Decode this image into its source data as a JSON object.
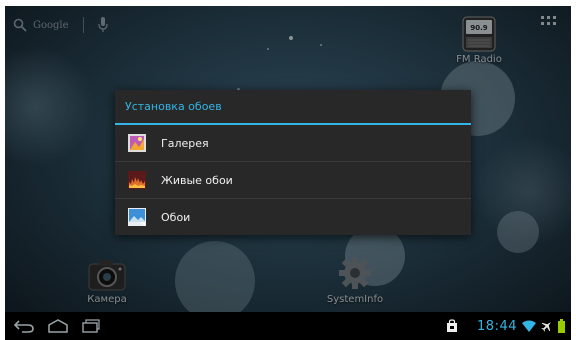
{
  "homescreen": {
    "search_label": "Google",
    "shortcuts": {
      "fm_radio": {
        "label": "FM Radio",
        "badge": "90.9"
      },
      "camera": {
        "label": "Камера"
      },
      "systeminfo": {
        "label": "SystemInfo"
      }
    }
  },
  "dialog": {
    "title": "Установка обоев",
    "items": [
      {
        "label": "Галерея",
        "icon": "gallery-icon"
      },
      {
        "label": "Живые обои",
        "icon": "live-wallpaper-icon"
      },
      {
        "label": "Обои",
        "icon": "wallpaper-icon"
      }
    ]
  },
  "statusbar": {
    "time": "18:44",
    "icons": [
      "notification-bag-icon",
      "wifi-icon",
      "airplane-icon",
      "battery-icon"
    ]
  },
  "navbar": {
    "icons": [
      "back-icon",
      "home-icon",
      "recent-apps-icon"
    ]
  },
  "colors": {
    "accent": "#33b5e5",
    "dialog_bg": "#282828",
    "nav_bg": "#000000",
    "battery": "#99cc00"
  }
}
